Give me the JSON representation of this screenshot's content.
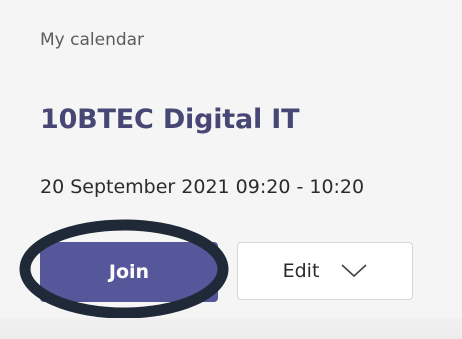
{
  "calendar": {
    "label": "My calendar"
  },
  "meeting": {
    "title": "10BTEC Digital IT",
    "time": "20 September 2021 09:20 - 10:20"
  },
  "actions": {
    "join_label": "Join",
    "edit_label": "Edit",
    "edit_icon": "chevron-down-icon"
  },
  "colors": {
    "accent": "#56569b",
    "title": "#464775",
    "highlight_ring": "#1f2937"
  }
}
